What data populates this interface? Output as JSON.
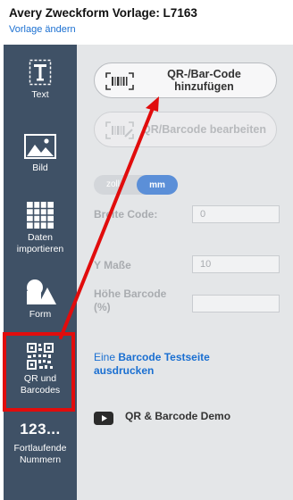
{
  "header": {
    "title": "Avery Zweckform Vorlage: L7163",
    "change_link": "Vorlage ändern"
  },
  "sidebar": {
    "items": [
      {
        "label": "Text",
        "icon": "text-icon"
      },
      {
        "label": "Bild",
        "icon": "image-icon"
      },
      {
        "label": "Daten importieren",
        "icon": "table-icon"
      },
      {
        "label": "Form",
        "icon": "shapes-icon"
      },
      {
        "label": "QR und Barcodes",
        "icon": "qr-code-icon"
      },
      {
        "label": "Fortlaufende Nummern",
        "icon": "numbering-icon",
        "glyph": "123..."
      }
    ]
  },
  "panel": {
    "add_button": "QR-/Bar-Code hinzufügen",
    "edit_button": "QR/Barcode bearbeiten",
    "unit_toggle": {
      "options": [
        "zoll",
        "mm"
      ],
      "selected": "mm"
    },
    "fields": [
      {
        "label": "Breite Code:",
        "value": "0"
      },
      {
        "label": "Y Maße",
        "value": "10"
      },
      {
        "label": "Höhe Barcode (%)",
        "value": ""
      }
    ],
    "test_page_link": {
      "prefix": "Eine ",
      "emphasis": "Barcode Testseite",
      "suffix": " ausdrucken"
    },
    "demo_label": "QR & Barcode Demo"
  },
  "colors": {
    "sidebar_bg": "#3f5166",
    "panel_bg": "#e4e6e8",
    "accent_blue": "#5b8fd8",
    "link_blue": "#1a6fd1",
    "highlight_red": "#e10c0c",
    "youtube_dark": "#2b2b2b"
  }
}
